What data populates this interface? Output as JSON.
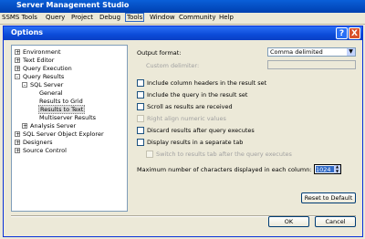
{
  "app": {
    "title": "Server Management Studio",
    "menu": [
      "SSMS Tools",
      "Query",
      "Project",
      "Debug",
      "Tools",
      "Window",
      "Community",
      "Help"
    ]
  },
  "dialog": {
    "title": "Options",
    "help_button": "?",
    "close_button": "X"
  },
  "tree": {
    "items": [
      {
        "label": "Environment",
        "expander": "+"
      },
      {
        "label": "Text Editor",
        "expander": "+"
      },
      {
        "label": "Query Execution",
        "expander": "+"
      },
      {
        "label": "Query Results",
        "expander": "-"
      },
      {
        "label": "SQL Server",
        "expander": "-"
      },
      {
        "label": "General",
        "expander": ""
      },
      {
        "label": "Results to Grid",
        "expander": ""
      },
      {
        "label": "Results to Text",
        "expander": ""
      },
      {
        "label": "Multiserver Results",
        "expander": ""
      },
      {
        "label": "Analysis Server",
        "expander": "+"
      },
      {
        "label": "SQL Server Object Explorer",
        "expander": "+"
      },
      {
        "label": "Designers",
        "expander": "+"
      },
      {
        "label": "Source Control",
        "expander": "+"
      }
    ]
  },
  "settings": {
    "output_format_label": "Output format:",
    "output_format_value": "Comma delimited",
    "custom_delimiter_label": "Custom delimiter:",
    "custom_delimiter_value": "",
    "checkboxes": [
      {
        "label": "Include column headers in the result set",
        "checked": false,
        "enabled": true
      },
      {
        "label": "Include the query in the result set",
        "checked": false,
        "enabled": true
      },
      {
        "label": "Scroll as results are received",
        "checked": false,
        "enabled": true
      },
      {
        "label": "Right align numeric values",
        "checked": false,
        "enabled": false
      },
      {
        "label": "Discard results after query executes",
        "checked": false,
        "enabled": true
      },
      {
        "label": "Display results in a separate tab",
        "checked": false,
        "enabled": true
      },
      {
        "label": "Switch to results tab after the query executes",
        "checked": false,
        "enabled": false
      }
    ],
    "max_chars_label": "Maximum number of characters displayed in each column:",
    "max_chars_value": "1024",
    "reset_button": "Reset to Default"
  },
  "footer": {
    "ok_button": "OK",
    "cancel_button": "Cancel"
  }
}
